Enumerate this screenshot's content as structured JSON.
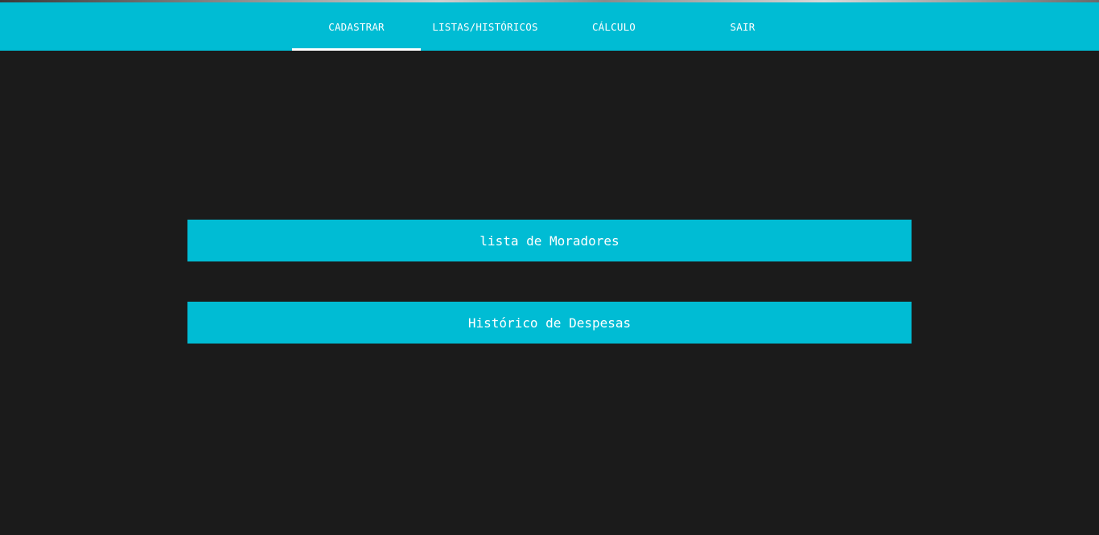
{
  "colors": {
    "primary": "#00bcd4",
    "background": "#1b1b1b",
    "text": "#ffffff"
  },
  "nav": {
    "tabs": [
      {
        "label": "CADASTRAR",
        "active": true
      },
      {
        "label": "LISTAS/HISTÓRICOS",
        "active": false
      },
      {
        "label": "CÁLCULO",
        "active": false
      },
      {
        "label": "SAIR",
        "active": false
      }
    ]
  },
  "main": {
    "buttons": [
      {
        "label": "lista de Moradores"
      },
      {
        "label": "Histórico de Despesas"
      }
    ]
  }
}
